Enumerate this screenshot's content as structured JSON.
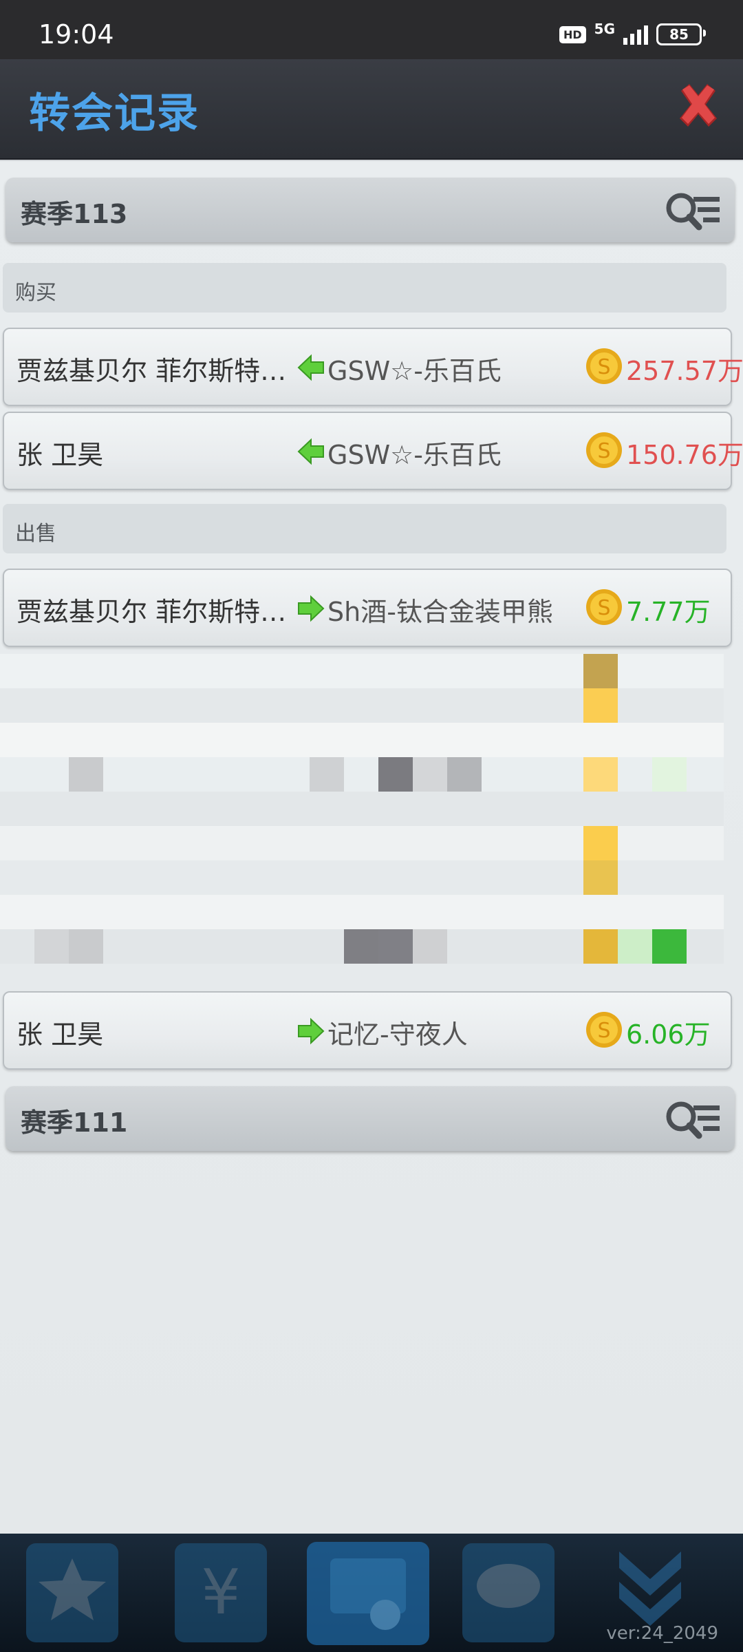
{
  "status_bar": {
    "time": "19:04",
    "hd": "HD",
    "network": "5G",
    "battery": "85"
  },
  "header": {
    "title": "转会记录",
    "close_icon": "close-x-icon"
  },
  "seasons": [
    {
      "label": "赛季113",
      "sections": [
        {
          "label": "购买",
          "rows": [
            {
              "player": "贾兹基贝尔 菲尔斯特…",
              "direction": "in",
              "club": "GSW☆-乐百氏",
              "price": "257.57万"
            },
            {
              "player": "张 卫昊",
              "direction": "in",
              "club": "GSW☆-乐百氏",
              "price": "150.76万"
            }
          ]
        },
        {
          "label": "出售",
          "rows": [
            {
              "player": "贾兹基贝尔 菲尔斯特…",
              "direction": "out",
              "club": "Sh酒-钛合金装甲熊",
              "price": "7.77万"
            },
            {
              "player": "张 卫昊",
              "direction": "out",
              "club": "记忆-守夜人",
              "price": "6.06万"
            }
          ]
        }
      ]
    },
    {
      "label": "赛季111"
    }
  ],
  "colors": {
    "title": "#4da3ea",
    "buy_price": "#e05050",
    "sell_price": "#27b327",
    "close": "#d43a3a"
  },
  "bottom_nav": {
    "version": "ver:24_2049"
  }
}
